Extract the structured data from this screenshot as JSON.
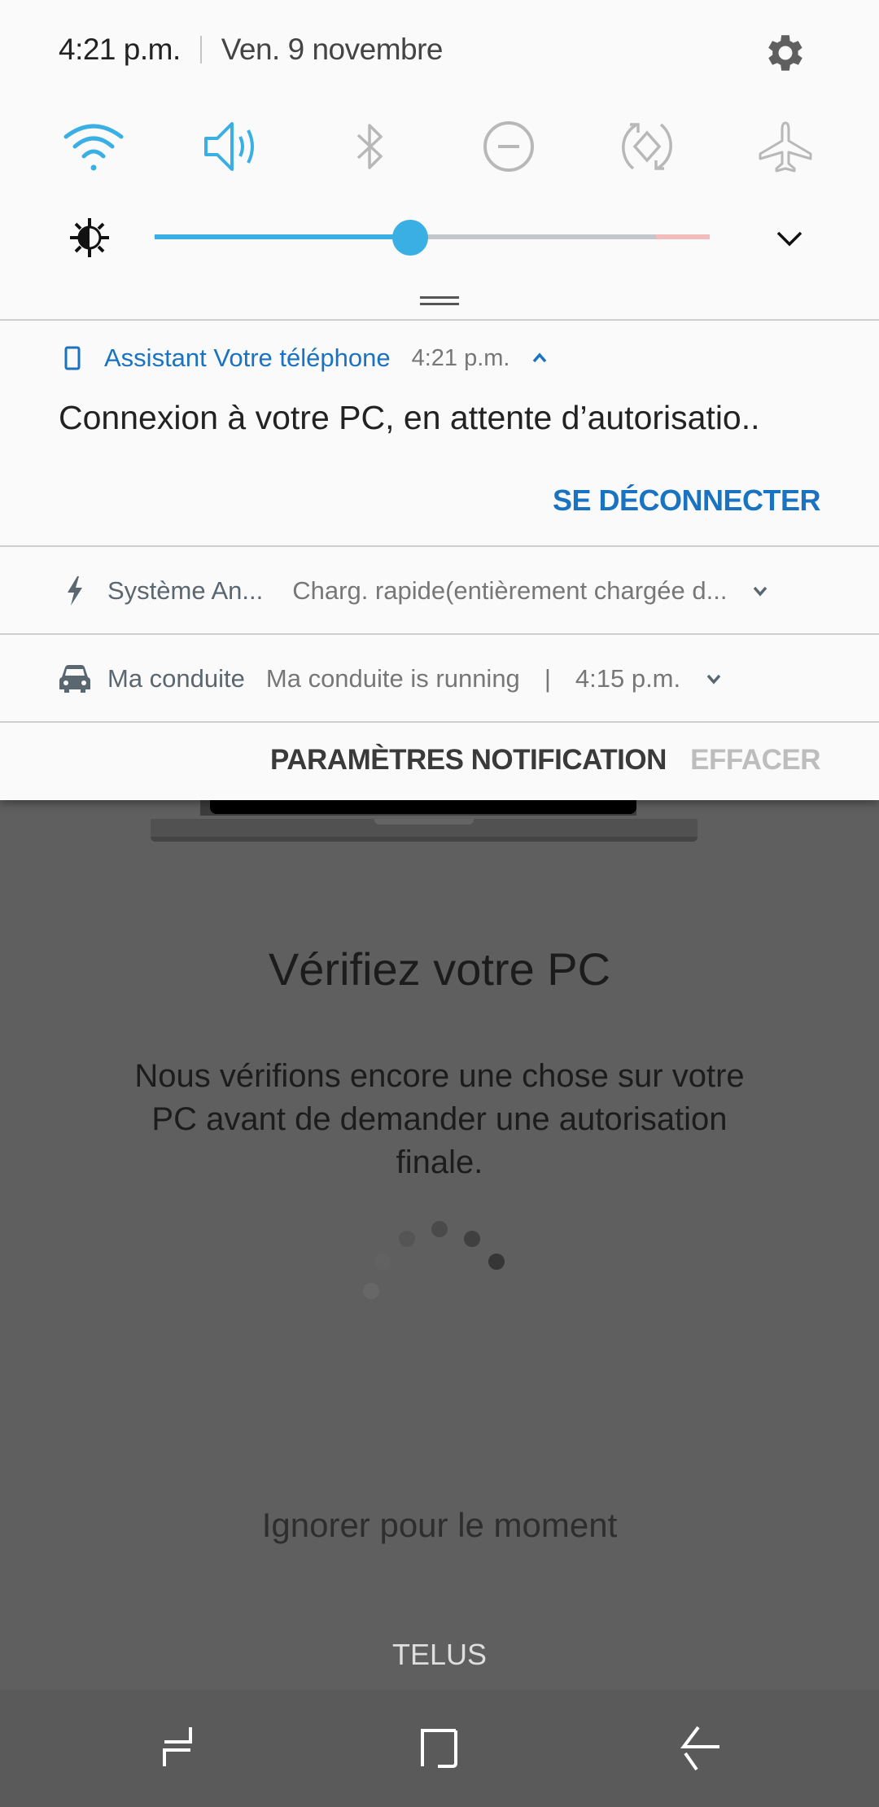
{
  "status": {
    "time": "4:21 p.m.",
    "date": "Ven. 9 novembre"
  },
  "quick_settings": [
    {
      "name": "wifi",
      "icon": "wifi-icon",
      "active": true
    },
    {
      "name": "sound",
      "icon": "volume-icon",
      "active": true
    },
    {
      "name": "bluetooth",
      "icon": "bluetooth-icon",
      "active": false
    },
    {
      "name": "do-not-disturb",
      "icon": "do-not-disturb-icon",
      "active": false
    },
    {
      "name": "auto-rotate",
      "icon": "auto-rotate-icon",
      "active": false
    },
    {
      "name": "airplane-mode",
      "icon": "airplane-icon",
      "active": false
    }
  ],
  "brightness": {
    "value_percent": 46
  },
  "colors": {
    "accent": "#3aafe4",
    "inactive_icon": "#b8b8b8",
    "link": "#1a73c0"
  },
  "notifications": {
    "main": {
      "app": "Assistant Votre téléphone",
      "time": "4:21 p.m.",
      "text": "Connexion à votre PC, en attente d’autorisatio..",
      "action": "SE DÉCONNECTER"
    },
    "system": {
      "app": "Système An...",
      "text": "Charg. rapide(entièrement chargée d..."
    },
    "driving": {
      "app": "Ma conduite",
      "text": "Ma conduite is running",
      "separator": "|",
      "time": "4:15 p.m."
    }
  },
  "footer": {
    "settings": "PARAMÈTRES NOTIFICATION",
    "clear": "EFFACER"
  },
  "app": {
    "title": "Vérifiez votre PC",
    "description": "Nous vérifions encore une chose sur votre PC avant de demander une autorisation finale.",
    "skip": "Ignorer pour le moment",
    "carrier": "TELUS"
  }
}
